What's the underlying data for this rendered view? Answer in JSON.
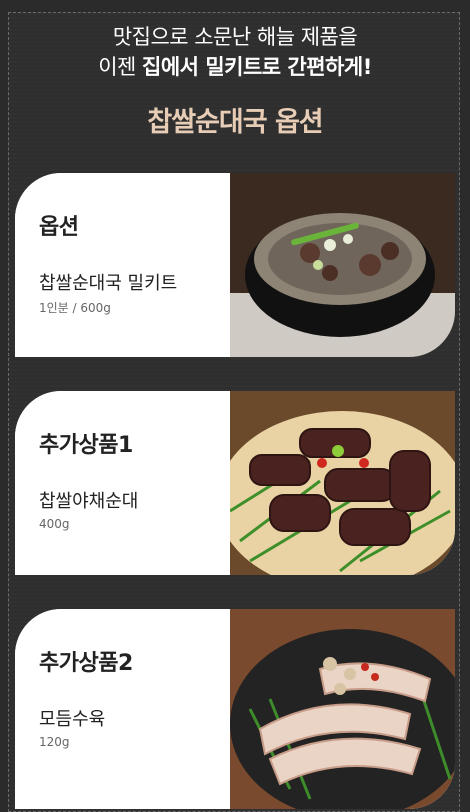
{
  "header": {
    "line1": "맛집으로 소문난 해늘 제품을",
    "line2_prefix": "이젠 ",
    "line2_bold": "집에서 밀키트로 간편하게!"
  },
  "section_title": "찹쌀순대국 옵션",
  "options": [
    {
      "category": "옵션",
      "name": "찹쌀순대국 밀키트",
      "spec": "1인분 / 600g",
      "photo_icon": "sundae-soup-photo"
    },
    {
      "category": "추가상품1",
      "name": "찹쌀야채순대",
      "spec": "400g",
      "photo_icon": "sundae-platter-photo"
    },
    {
      "category": "추가상품2",
      "name": "모듬수육",
      "spec": "120g",
      "photo_icon": "suyuk-platter-photo"
    }
  ],
  "colors": {
    "background": "#2e2e2e",
    "accent": "#e8cdb6",
    "card": "#ffffff"
  }
}
